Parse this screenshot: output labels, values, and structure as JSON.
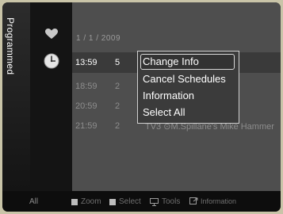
{
  "side_tab": {
    "label": "Programmed"
  },
  "schedule": {
    "date": "1 / 1 / 2009",
    "rows": [
      {
        "time": "13:59",
        "channel": "5",
        "program": ""
      },
      {
        "time": "18:59",
        "channel": "2",
        "program": ""
      },
      {
        "time": "20:59",
        "channel": "2",
        "program": ""
      },
      {
        "time": "21:59",
        "channel": "2",
        "program": "TV3   ⊙M.Spillane's Mike Hammer"
      }
    ]
  },
  "menu": {
    "items": [
      "Change Info",
      "Cancel Schedules",
      "Information",
      "Select All"
    ]
  },
  "bottom_bar": {
    "all_label": "All",
    "zoom_label": "Zoom",
    "select_label": "Select",
    "tools_label": "Tools",
    "information_label": "Information"
  },
  "colors": {
    "background": "#c9c4a8",
    "panel": "#4e4e4e",
    "highlight": "#d8d8d8"
  }
}
